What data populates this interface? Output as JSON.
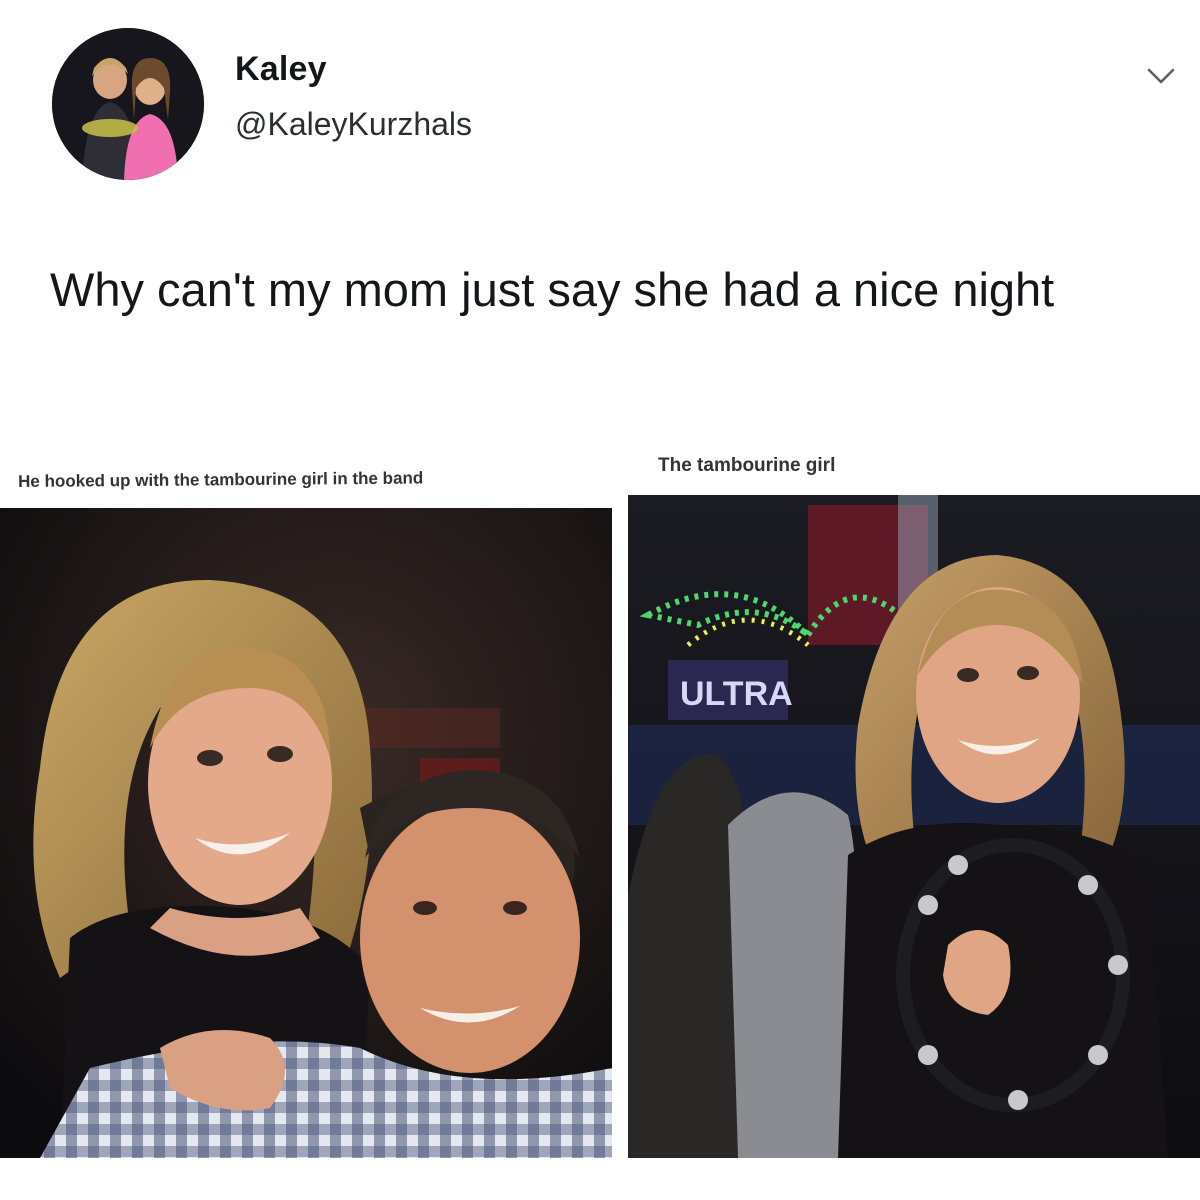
{
  "tweet": {
    "display_name": "Kaley",
    "handle": "@KaleyKurzhals",
    "text": "Why can't my mom just say she had a nice night",
    "menu_icon": "chevron-down-icon"
  },
  "images": [
    {
      "caption": "He hooked up with the tambourine girl in the band"
    },
    {
      "caption": "The tambourine girl",
      "sign_text": "ULTRA"
    }
  ],
  "colors": {
    "text": "#14171a",
    "caption": "#333333",
    "background": "#ffffff"
  }
}
